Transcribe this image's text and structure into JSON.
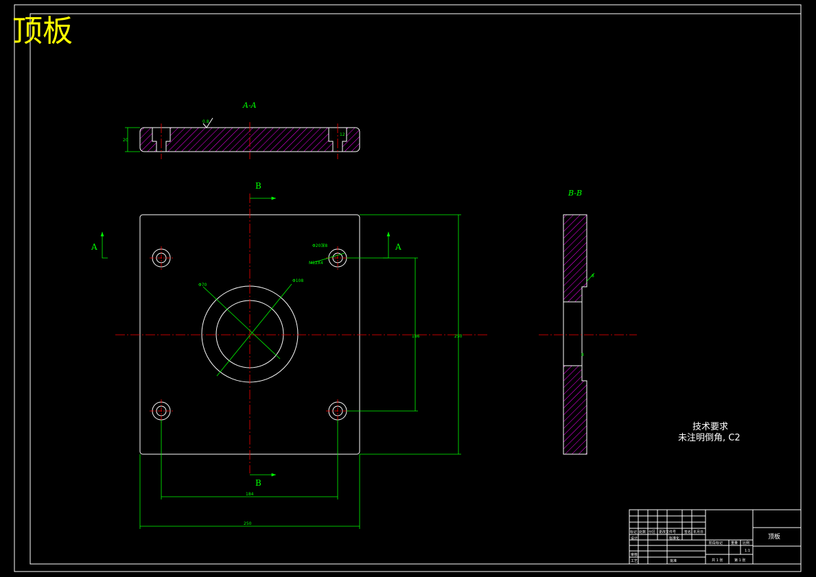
{
  "drawing": {
    "title": "顶板",
    "section_aa_label": "A-A",
    "section_bb_label": "B-B",
    "section_letter_a": "A",
    "section_letter_b": "B",
    "roughness_value": "0.8",
    "dimensions": {
      "plate_thickness": "20",
      "counterbore_depth": "12",
      "counterbore_callout": "Φ20深8",
      "bolt_hole_callout": "M12X4",
      "inner_diameter": "Φ70",
      "outer_diameter": "Φ108",
      "hole_spacing_vertical": "186",
      "plate_height": "250",
      "hole_spacing_horizontal": "184",
      "plate_width": "250",
      "side_step": "8",
      "side_slot": "8"
    },
    "technical_requirements": {
      "heading": "技术要求",
      "line1": "未注明倒角, C2"
    },
    "title_block": {
      "part_name": "顶板",
      "sheet_count": "共 1 张",
      "sheet_number": "第 1 张",
      "scale": "1:1",
      "row_labels": [
        "标记",
        "处数",
        "分区",
        "更改文件号",
        "签名",
        "年月日"
      ],
      "design_label": "设计",
      "standardization_label": "标准化",
      "review_label": "审核",
      "process_label": "工艺",
      "approve_label": "批准",
      "stage_label": "阶段标记",
      "weight_label": "重量",
      "scale_label": "比例"
    },
    "colors": {
      "background": "#000000",
      "outline": "#ffffff",
      "dimension": "#00ff00",
      "centerline": "#ff0000",
      "hatch": "#ff00ff",
      "title": "#ffff00"
    }
  }
}
